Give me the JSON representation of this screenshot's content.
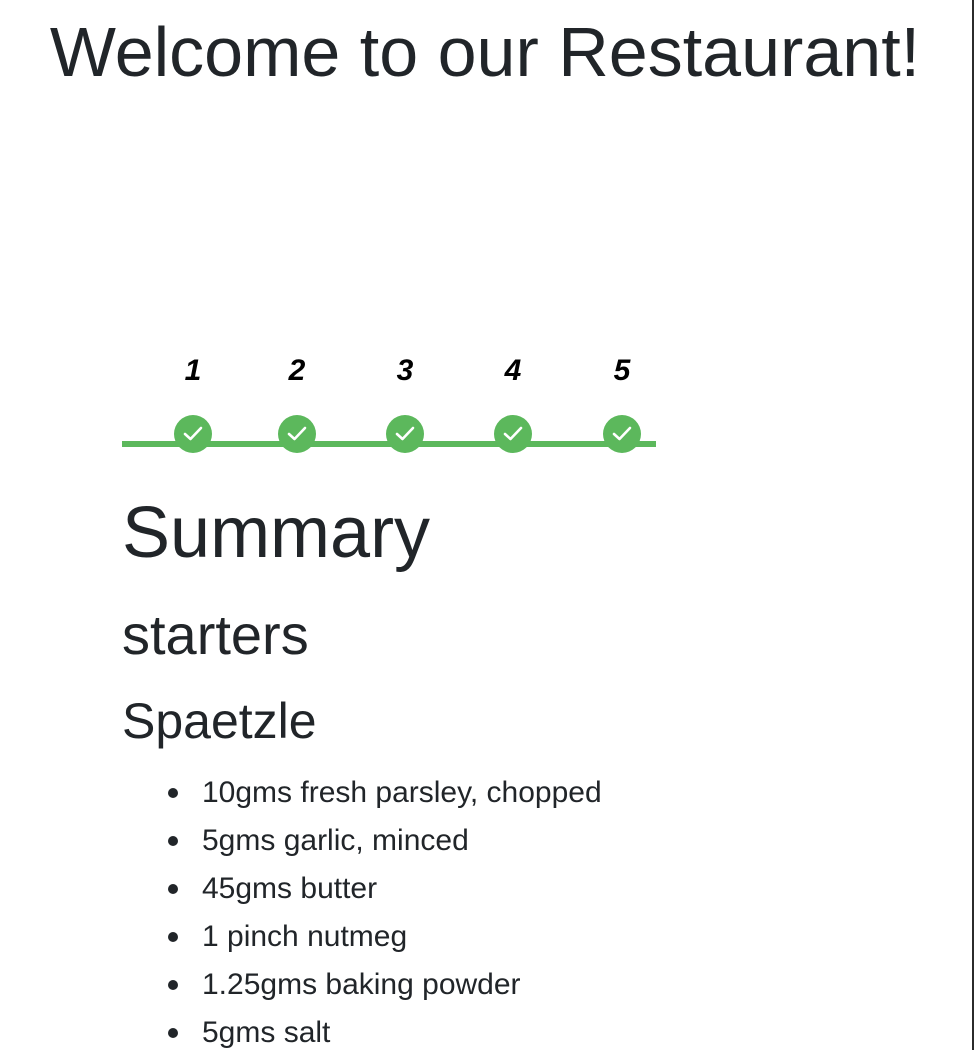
{
  "page": {
    "title": "Welcome to our Restaurant!"
  },
  "stepper": {
    "accent_color": "#5cb85c",
    "steps": [
      {
        "label": "1",
        "completed": true,
        "icon": "check-icon"
      },
      {
        "label": "2",
        "completed": true,
        "icon": "check-icon"
      },
      {
        "label": "3",
        "completed": true,
        "icon": "check-icon"
      },
      {
        "label": "4",
        "completed": true,
        "icon": "check-icon"
      },
      {
        "label": "5",
        "completed": true,
        "icon": "check-icon"
      }
    ]
  },
  "summary": {
    "heading": "Summary",
    "category": "starters",
    "dish": "Spaetzle",
    "ingredients": [
      "10gms fresh parsley, chopped",
      "5gms garlic, minced",
      "45gms butter",
      "1 pinch nutmeg",
      "1.25gms baking powder",
      "5gms salt"
    ]
  }
}
